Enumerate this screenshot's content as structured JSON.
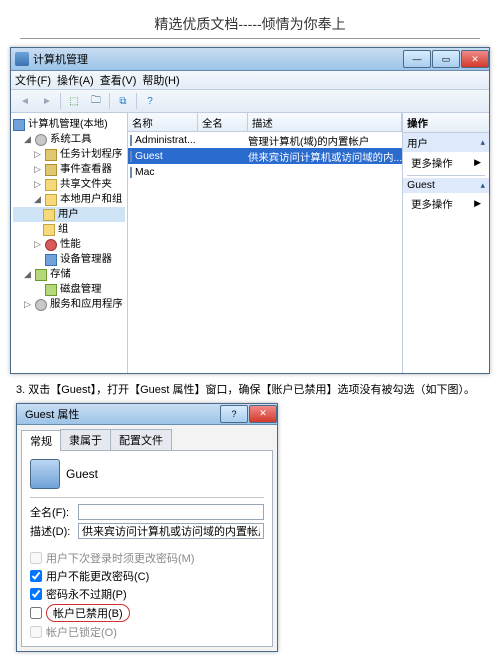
{
  "page_header": "精选优质文档-----倾情为你奉上",
  "window": {
    "title": "计算机管理",
    "menus": {
      "file": "文件(F)",
      "action": "操作(A)",
      "view": "查看(V)",
      "help": "帮助(H)"
    }
  },
  "tree": {
    "root": "计算机管理(本地)",
    "n1": "系统工具",
    "n1a": "任务计划程序",
    "n1b": "事件查看器",
    "n1c": "共享文件夹",
    "n1d": "本地用户和组",
    "n1d1": "用户",
    "n1d2": "组",
    "n1e": "性能",
    "n1f": "设备管理器",
    "n2": "存储",
    "n2a": "磁盘管理",
    "n3": "服务和应用程序"
  },
  "columns": {
    "name": "名称",
    "full": "全名",
    "desc": "描述"
  },
  "users": {
    "r0": {
      "name": "Administrat...",
      "full": "",
      "desc": "管理计算机(域)的内置帐户"
    },
    "r1": {
      "name": "Guest",
      "full": "",
      "desc": "供来宾访问计算机或访问域的内..."
    },
    "r2": {
      "name": "Mac",
      "full": "",
      "desc": ""
    }
  },
  "actions": {
    "header": "操作",
    "group1": "用户",
    "more": "更多操作",
    "group2": "Guest"
  },
  "instruction": "3. 双击【Guest】，打开【Guest 属性】窗口，确保【账户已禁用】选项没有被勾选（如下图）。",
  "dialog": {
    "title": "Guest 属性",
    "tabs": {
      "gen": "常规",
      "member": "隶属于",
      "profile": "配置文件"
    },
    "username": "Guest",
    "fullname_label": "全名(F):",
    "fullname": "",
    "desc_label": "描述(D):",
    "desc": "供来宾访问计算机或访问域的内置帐户",
    "chk1": "用户下次登录时须更改密码(M)",
    "chk2": "用户不能更改密码(C)",
    "chk3": "密码永不过期(P)",
    "chk4": "帐户已禁用(B)",
    "chk5": "帐户已锁定(O)"
  }
}
